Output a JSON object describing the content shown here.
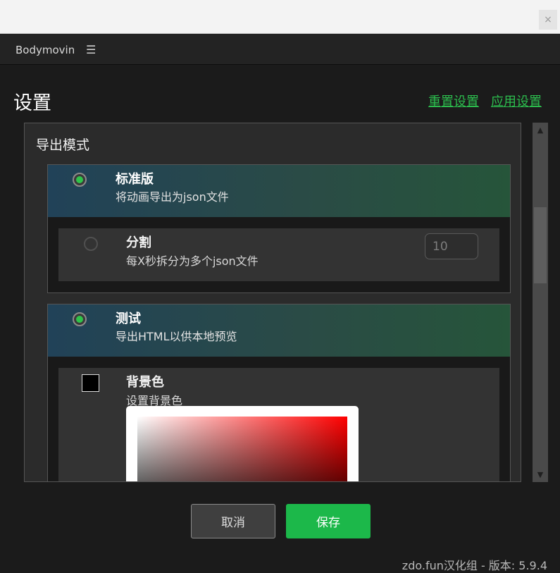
{
  "window": {
    "close_label": "×"
  },
  "panel": {
    "title": "Bodymovin",
    "menu_icon": "☰"
  },
  "settings": {
    "title": "设置",
    "reset_link": "重置设置",
    "apply_link": "应用设置"
  },
  "export_mode": {
    "title": "导出模式",
    "standard": {
      "title": "标准版",
      "desc": "将动画导出为json文件",
      "selected": true,
      "split": {
        "title": "分割",
        "desc": "每X秒拆分为多个json文件",
        "value": "10"
      }
    },
    "test": {
      "title": "测试",
      "desc": "导出HTML以供本地预览",
      "selected": true,
      "background": {
        "title": "背景色",
        "desc": "设置背景色",
        "color": "#000000"
      }
    }
  },
  "buttons": {
    "cancel": "取消",
    "save": "保存"
  },
  "footer": {
    "version": "zdo.fun汉化组 - 版本: 5.9.4"
  },
  "colors": {
    "accent": "#2cbe4e",
    "save_button": "#1cb84a"
  }
}
